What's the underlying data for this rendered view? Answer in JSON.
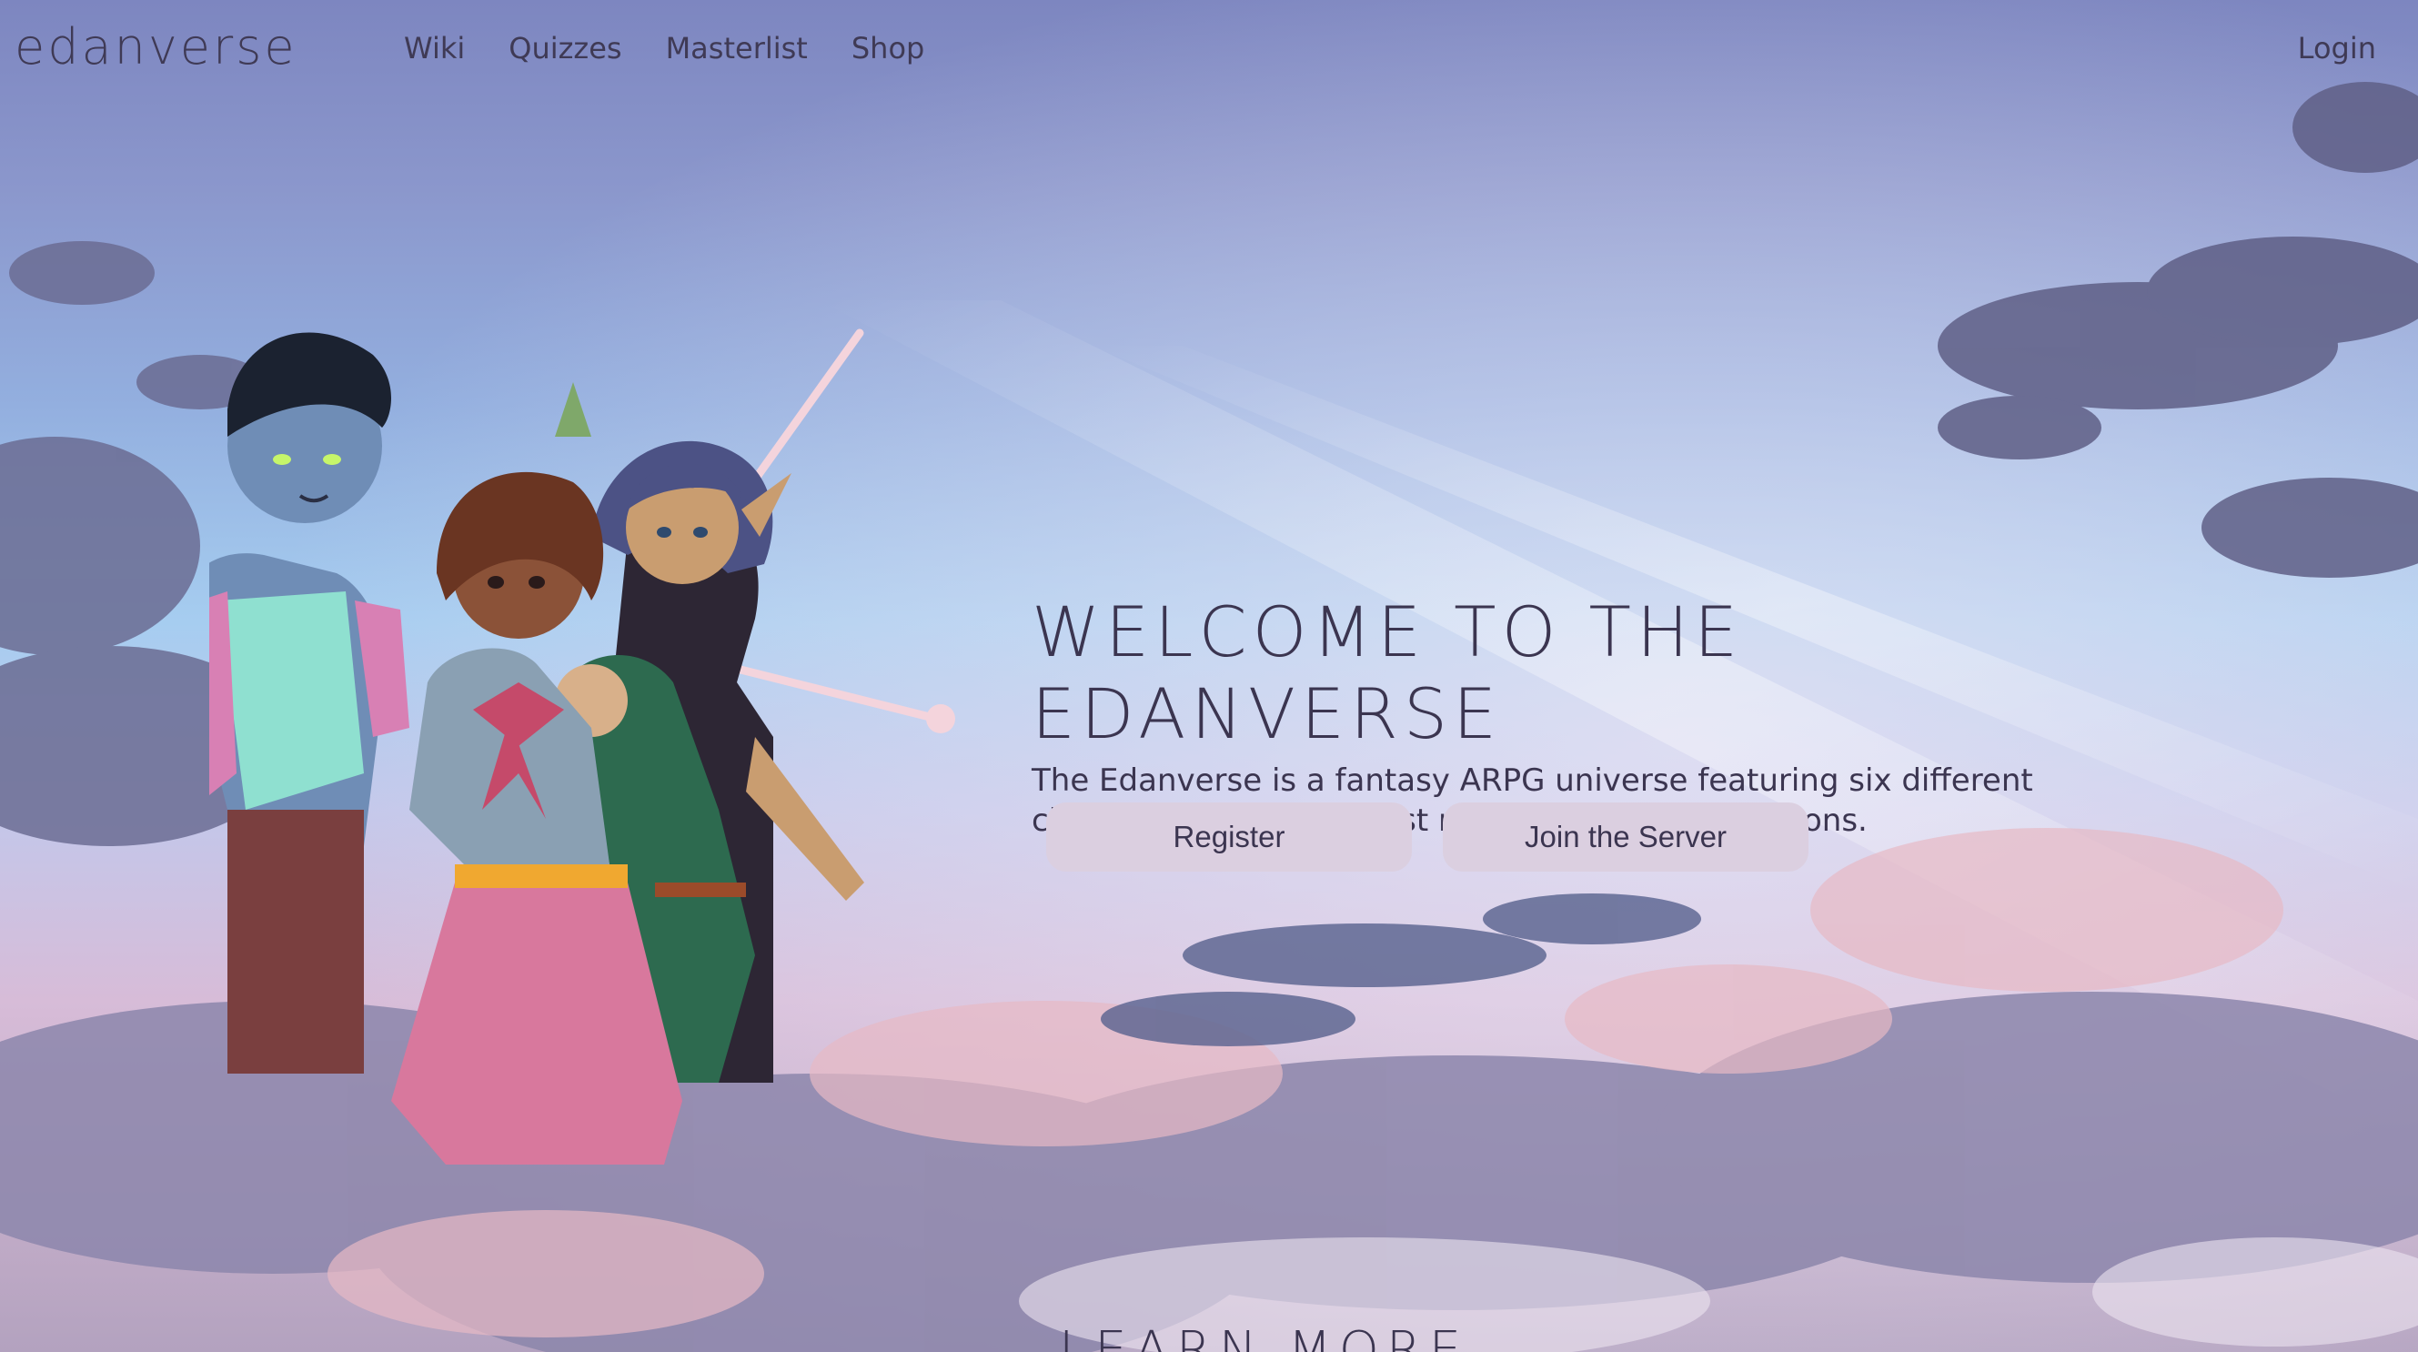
{
  "nav": {
    "logo": "edanverse",
    "links": [
      "Wiki",
      "Quizzes",
      "Masterlist",
      "Shop"
    ],
    "login": "Login"
  },
  "hero": {
    "title": "Welcome to the Edanverse",
    "description": "The Edanverse is a fantasy ARPG universe featuring six different closed species and a vast range of different locations.",
    "buttons": {
      "register": "Register",
      "join": "Join the Server"
    },
    "learn_more": "Learn More"
  },
  "colors": {
    "text": "#3b3550",
    "button_bg": "#dbcfe0",
    "constellation": "#f4d4dc"
  }
}
